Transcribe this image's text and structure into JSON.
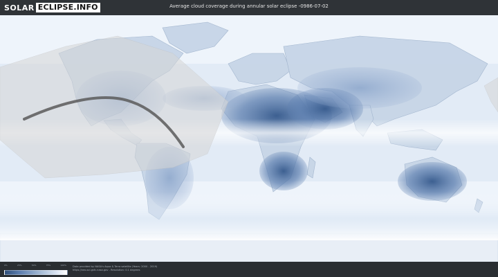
{
  "logo": {
    "left": "SOLAR",
    "right": "ECLIPSE.INFO"
  },
  "title": "Average cloud coverage during annular solar eclipse -0986-07-02",
  "legend": {
    "ticks": [
      "0%",
      "25%",
      "50%",
      "75%",
      "100%"
    ]
  },
  "credits": {
    "line1": "Data provided by NASA's Aqua & Terra satellite (Years: 2000 - 2019)",
    "line2": "https://neo.sci.gsfc.nasa.gov - Resolution: 0.1 degrees"
  },
  "colors": {
    "clouds": "#ffffff",
    "clear_sky": "#3f5f8f",
    "eclipse_zone": "#d6d6d6",
    "eclipse_path": "#5a5a5a"
  }
}
